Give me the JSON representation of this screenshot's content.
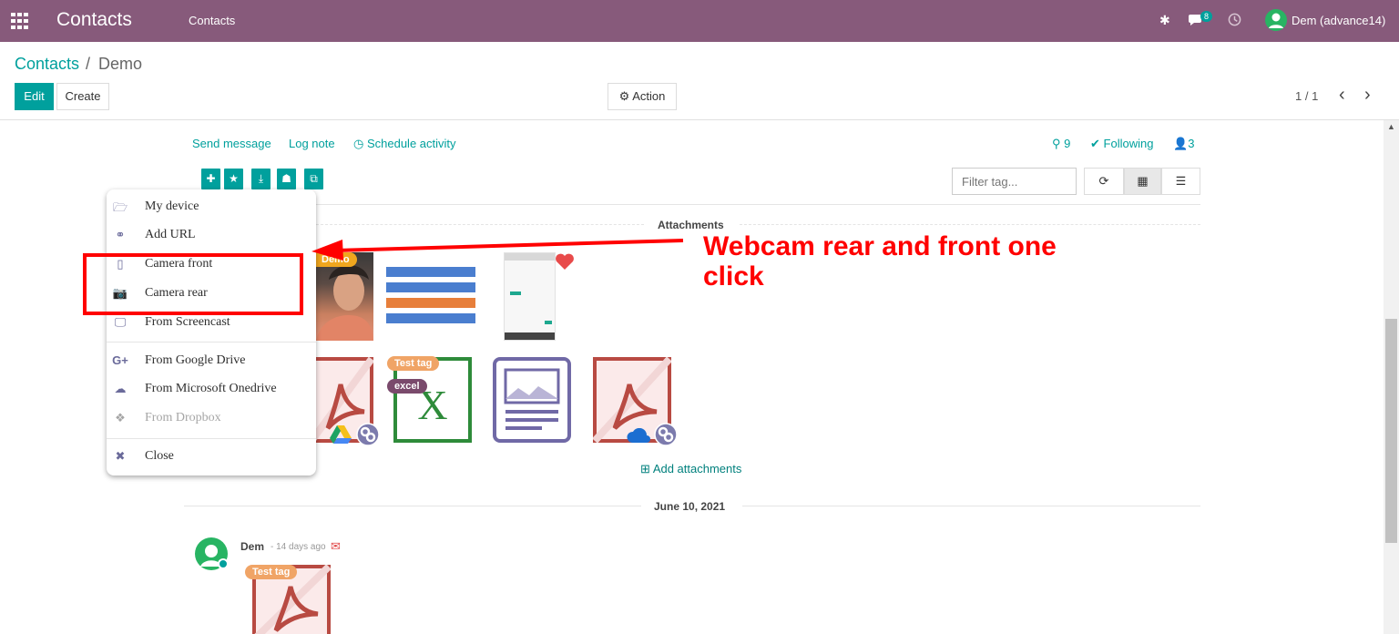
{
  "navbar": {
    "app_name": "Contacts",
    "menu": "Contacts",
    "chat_count": "8",
    "user": "Dem (advance14)"
  },
  "breadcrumb": {
    "parent": "Contacts",
    "sep": "/",
    "current": "Demo"
  },
  "buttons": {
    "edit": "Edit",
    "create": "Create",
    "action": "Action",
    "pager": "1 / 1"
  },
  "chatter": {
    "send_message": "Send message",
    "log_note": "Log note",
    "schedule": "Schedule activity",
    "attachments_count": "9",
    "following": "Following",
    "followers_count": "3"
  },
  "filter": {
    "placeholder": "Filter tag..."
  },
  "dropdown": [
    {
      "label": "My device",
      "icon": "folder-open-icon"
    },
    {
      "label": "Add URL",
      "icon": "link-icon"
    },
    {
      "label": "Camera front",
      "icon": "mobile-icon"
    },
    {
      "label": "Camera rear",
      "icon": "camera-icon"
    },
    {
      "label": "From Screencast",
      "icon": "desktop-icon"
    },
    {
      "label": "From Google Drive",
      "icon": "google-plus-icon"
    },
    {
      "label": "From Microsoft Onedrive",
      "icon": "cloud-icon"
    },
    {
      "label": "From Dropbox",
      "icon": "dropbox-icon"
    },
    {
      "label": "Close",
      "icon": "close-icon"
    }
  ],
  "attachments": {
    "title": "Attachments",
    "add_label": "Add attachments",
    "tags": {
      "demo": "Demo",
      "test": "Test tag",
      "excel": "excel"
    }
  },
  "annotation": {
    "line1": "Webcam rear and front one",
    "line2": "click",
    "color": "#ff0000"
  },
  "date_separator": "June 10, 2021",
  "message": {
    "author": "Dem",
    "time": "- 14 days ago",
    "tag": "Test tag"
  }
}
